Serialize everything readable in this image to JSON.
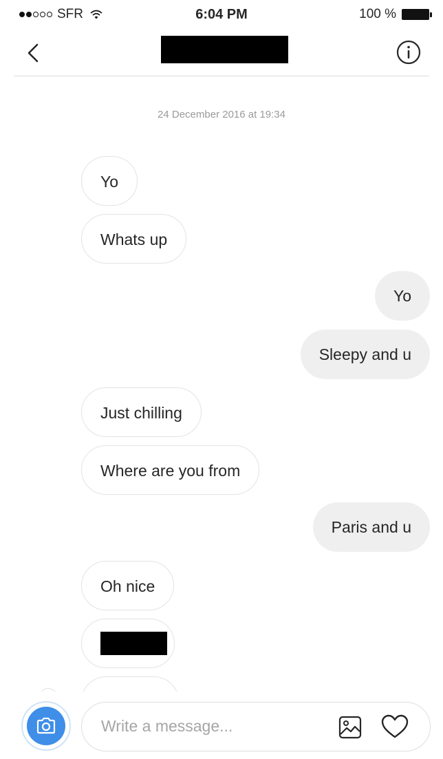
{
  "status_bar": {
    "carrier": "SFR",
    "time": "6:04 PM",
    "battery": "100 %",
    "signal_bars_filled": 2,
    "signal_bars_total": 5
  },
  "header": {
    "back_icon": "chevron-left-icon",
    "title_redacted": true,
    "info_icon": "info-circle-icon"
  },
  "conversation": {
    "timestamp": "24 December 2016 at 19:34",
    "messages": [
      {
        "direction": "received",
        "text": "Yo"
      },
      {
        "direction": "received",
        "text": "Whats up"
      },
      {
        "direction": "sent",
        "text": "Yo"
      },
      {
        "direction": "sent",
        "text": "Sleepy and u"
      },
      {
        "direction": "received",
        "text": "Just chilling"
      },
      {
        "direction": "received",
        "text": "Where are you from"
      },
      {
        "direction": "sent",
        "text": "Paris and u"
      },
      {
        "direction": "received",
        "text": "Oh nice"
      },
      {
        "direction": "received",
        "text": "",
        "redacted": true
      },
      {
        "direction": "received",
        "text": "",
        "partially_visible": true
      }
    ]
  },
  "composer": {
    "placeholder": "Write a message...",
    "value": "",
    "camera_icon": "camera-icon",
    "gallery_icon": "image-icon",
    "like_icon": "heart-icon"
  },
  "colors": {
    "accent": "#3f8ee8",
    "sent_bubble": "#efefef",
    "received_border": "#e3e3e3",
    "timestamp_text": "#9a9a9a"
  }
}
